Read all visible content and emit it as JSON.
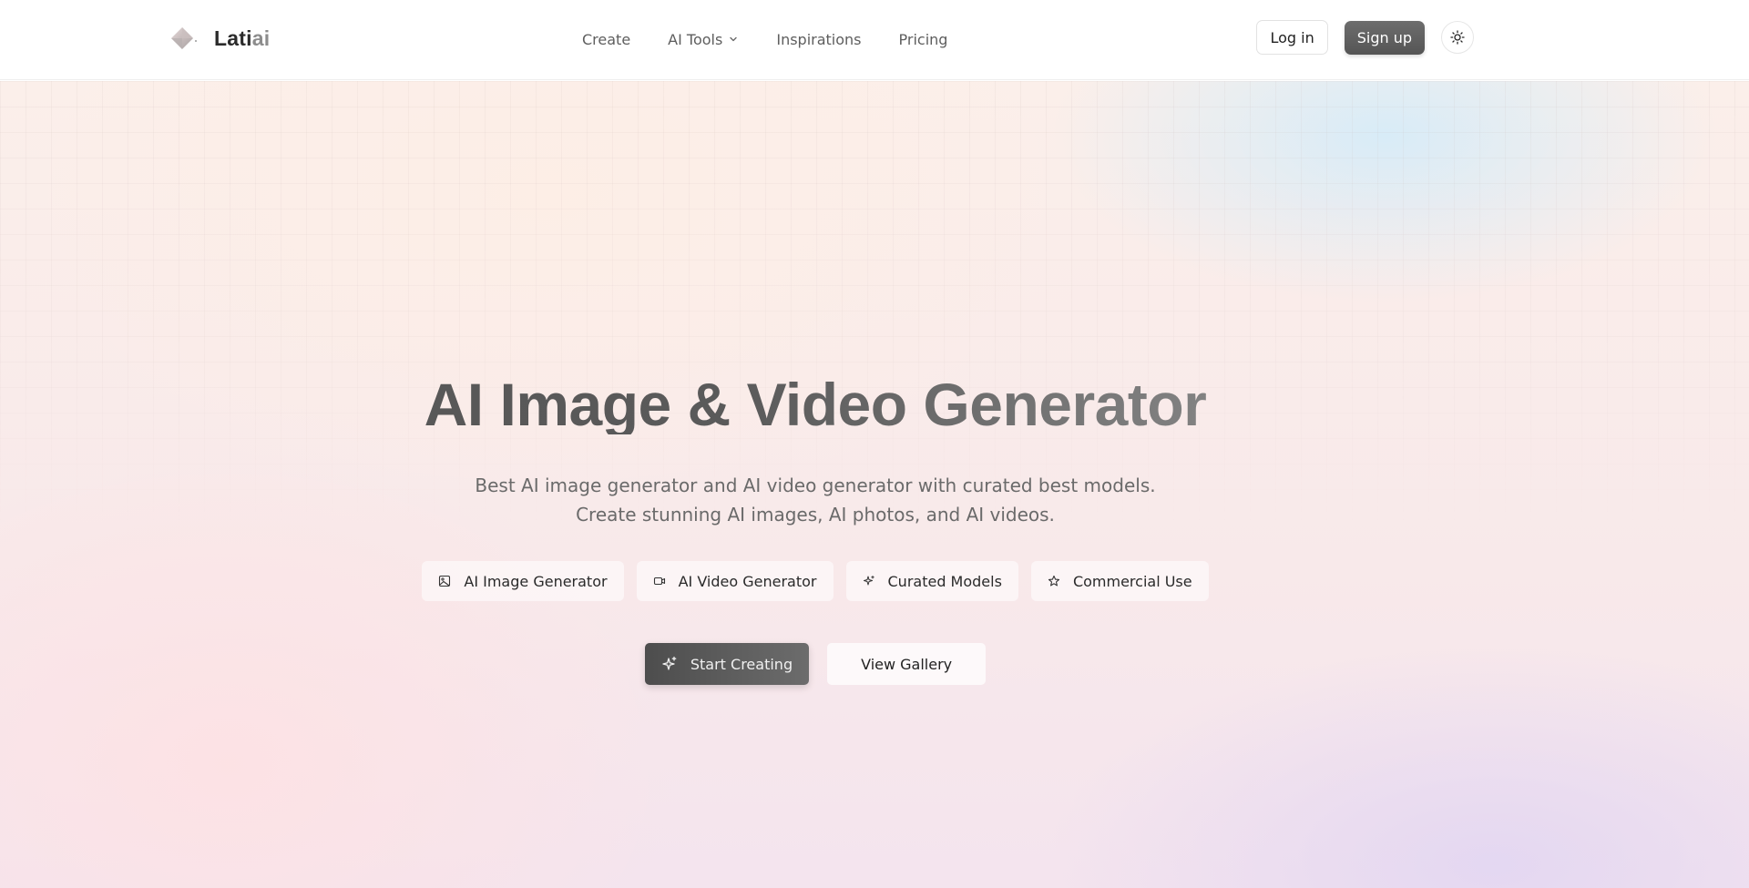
{
  "header": {
    "brand": {
      "name_main": "Lati",
      "name_accent": "ai"
    },
    "nav": [
      {
        "label": "Create",
        "icon": ""
      },
      {
        "label": "AI Tools",
        "icon": "chevron-down-icon"
      },
      {
        "label": "Inspirations",
        "icon": ""
      },
      {
        "label": "Pricing",
        "icon": ""
      }
    ],
    "login_label": "Log in",
    "signup_label": "Sign up",
    "theme_icon": "sun-icon"
  },
  "hero": {
    "title": "AI Image & Video Generator",
    "subtitle_line1": "Best AI image generator and AI video generator with curated best models.",
    "subtitle_line2": "Create stunning AI images, AI photos, and AI videos.",
    "features": [
      {
        "label": "AI Image Generator",
        "icon": "image-icon"
      },
      {
        "label": "AI Video Generator",
        "icon": "video-icon"
      },
      {
        "label": "Curated Models",
        "icon": "sparkles-icon"
      },
      {
        "label": "Commercial Use",
        "icon": "star-icon"
      }
    ],
    "primary_cta": "Start Creating",
    "secondary_cta": "View Gallery"
  },
  "colors": {
    "header_bg": "#ffffff",
    "signup_bg": "#606060",
    "primary_cta_bg": "#555555",
    "text_dark": "#2b2b2b",
    "text_muted": "#6a6a6a"
  }
}
